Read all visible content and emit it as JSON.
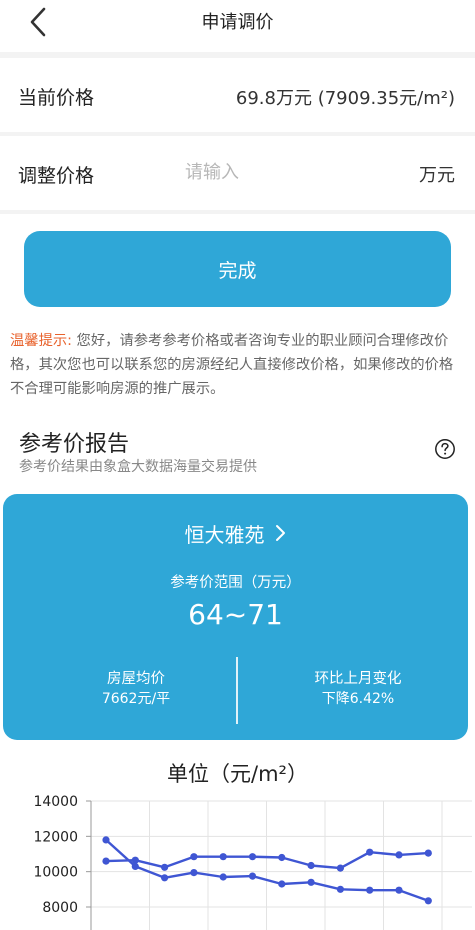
{
  "header": {
    "title": "申请调价"
  },
  "current_price": {
    "label": "当前价格",
    "value": "69.8万元 (7909.35元/m²)"
  },
  "adjust_price": {
    "label": "调整价格",
    "placeholder": "请输入",
    "unit": "万元"
  },
  "done_button": {
    "label": "完成"
  },
  "tip": {
    "heading": "温馨提示:",
    "body": " 您好，请参考参考价格或者咨询专业的职业顾问合理修改价格，其次您也可以联系您的房源经纪人直接修改价格，如果修改的价格不合理可能影响房源的推广展示。"
  },
  "report": {
    "title": "参考价报告",
    "subtitle": "参考价结果由象盒大数据海量交易提供",
    "community": "恒大雅苑",
    "range_label": "参考价范围（万元）",
    "range_value": "64~71",
    "avg_price_label": "房屋均价",
    "avg_price_value": "7662元/平",
    "mom_label": "环比上月变化",
    "mom_value": "下降6.42%"
  },
  "colors": {
    "accent": "#2fa7d7",
    "tip_heading": "#e8622c",
    "line": "#3f56d3"
  },
  "chart_data": {
    "type": "line",
    "title": "单位（元/m²）",
    "ylim": [
      8000,
      14000
    ],
    "yticks": [
      "14000",
      "12000",
      "10000",
      "8000"
    ],
    "grid": true,
    "series": [
      {
        "values": [
          10600,
          10650,
          10250,
          10850,
          10850,
          10850,
          10800,
          10350,
          10200,
          11100,
          10950,
          11050
        ]
      },
      {
        "values": [
          11800,
          10300,
          9650,
          9950,
          9700,
          9750,
          9300,
          9400,
          9000,
          8950,
          8950,
          8350
        ]
      }
    ]
  }
}
